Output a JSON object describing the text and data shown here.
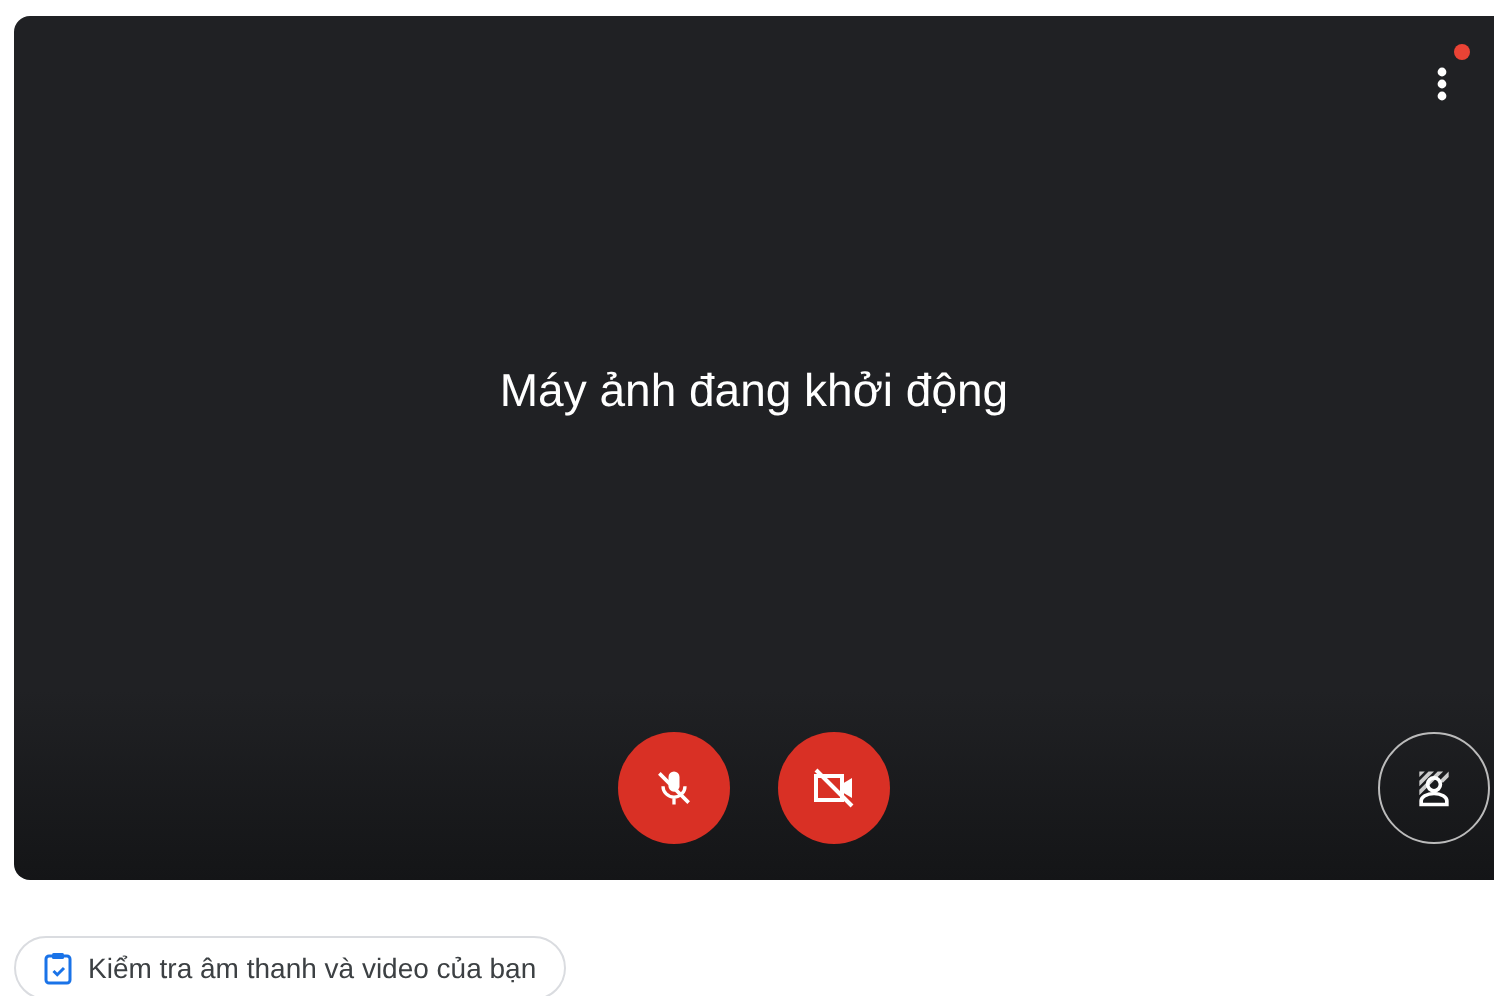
{
  "preview": {
    "message": "Máy ảnh đang khởi động",
    "notification": true
  },
  "controls": [
    {
      "kind": "mic",
      "on": false
    },
    {
      "kind": "camera",
      "on": false
    }
  ],
  "check_button": {
    "label": "Kiểm tra âm thanh và video của bạn"
  }
}
